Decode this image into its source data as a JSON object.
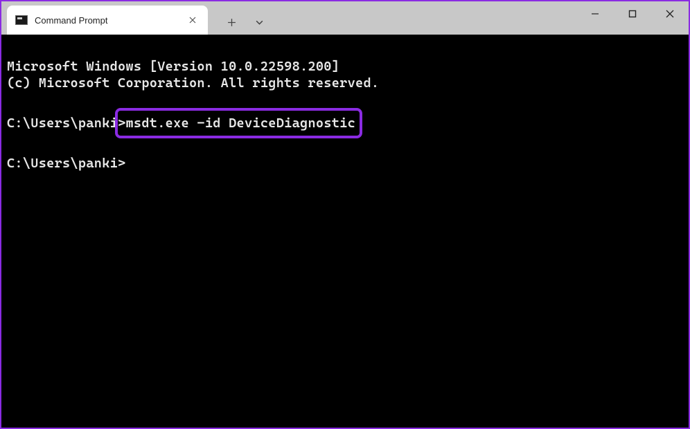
{
  "titlebar": {
    "tab_title": "Command Prompt"
  },
  "terminal": {
    "line1": "Microsoft Windows [Version 10.0.22598.200]",
    "line2": "(c) Microsoft Corporation. All rights reserved.",
    "blank": "",
    "prompt1_prefix": "C:\\Users\\panki",
    "prompt1_command": ">msdt.exe -id DeviceDiagnostic",
    "prompt2": "C:\\Users\\panki>"
  },
  "highlight_color": "#8a2be2"
}
